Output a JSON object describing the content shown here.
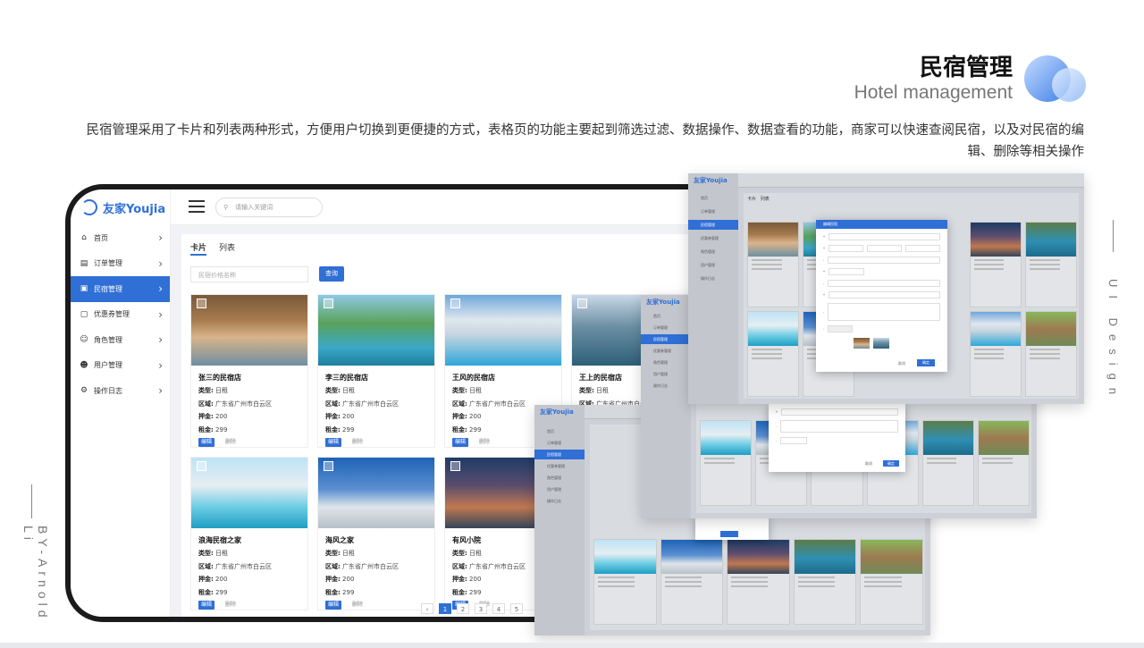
{
  "header": {
    "title": "民宿管理",
    "subtitle": "Hotel management",
    "description": "民宿管理采用了卡片和列表两种形式，方便用户切换到更便捷的方式，表格页的功能主要起到筛选过滤、数据操作、数据查看的功能，商家可以快速查阅民宿，以及对民宿的编辑、删除等相关操作"
  },
  "side_text": {
    "left": "BY-Arnold Li",
    "right": "UI Design"
  },
  "app": {
    "logo": "友家Youjia",
    "search_placeholder": "请输入关键词",
    "menu": [
      {
        "label": "首页",
        "icon": "home-icon"
      },
      {
        "label": "订单管理",
        "icon": "order-icon"
      },
      {
        "label": "民宿管理",
        "icon": "hotel-icon",
        "active": true
      },
      {
        "label": "优惠券管理",
        "icon": "coupon-icon"
      },
      {
        "label": "角色管理",
        "icon": "role-icon"
      },
      {
        "label": "用户管理",
        "icon": "user-icon"
      },
      {
        "label": "操作日志",
        "icon": "log-icon"
      }
    ],
    "tabs": [
      "卡片",
      "列表"
    ],
    "filter_placeholder": "民宿价格名称",
    "query_button": "查询",
    "field_labels": {
      "type": "类型:",
      "area": "区域:",
      "deposit": "押金:",
      "rent": "租金:"
    },
    "edit_label": "编辑",
    "delete_label": "删除",
    "cards": [
      {
        "name": "张三的民宿店",
        "type": "日租",
        "area": "广东省广州市白云区",
        "deposit": "200",
        "rent": "299"
      },
      {
        "name": "李三的民宿店",
        "type": "日租",
        "area": "广东省广州市白云区",
        "deposit": "200",
        "rent": "299"
      },
      {
        "name": "王风的民宿店",
        "type": "日租",
        "area": "广东省广州市白云区",
        "deposit": "200",
        "rent": "299"
      },
      {
        "name": "王上的民宿店",
        "type": "日租",
        "area": "广东省广州市白云区",
        "deposit": "200",
        "rent": "299"
      },
      {
        "name": "浪海民宿之家",
        "type": "日租",
        "area": "广东省广州市白云区",
        "deposit": "200",
        "rent": "299"
      },
      {
        "name": "海风之家",
        "type": "日租",
        "area": "广东省广州市白云区",
        "deposit": "200",
        "rent": "299"
      },
      {
        "name": "有风小院",
        "type": "日租",
        "area": "广东省广州市白云区",
        "deposit": "200",
        "rent": "299"
      }
    ],
    "pages": [
      "1",
      "2",
      "3",
      "4",
      "5"
    ],
    "modal_title": "编辑民宿",
    "modal_cancel": "取消",
    "modal_confirm": "确定"
  },
  "colors": {
    "accent": "#2f6fd6"
  }
}
